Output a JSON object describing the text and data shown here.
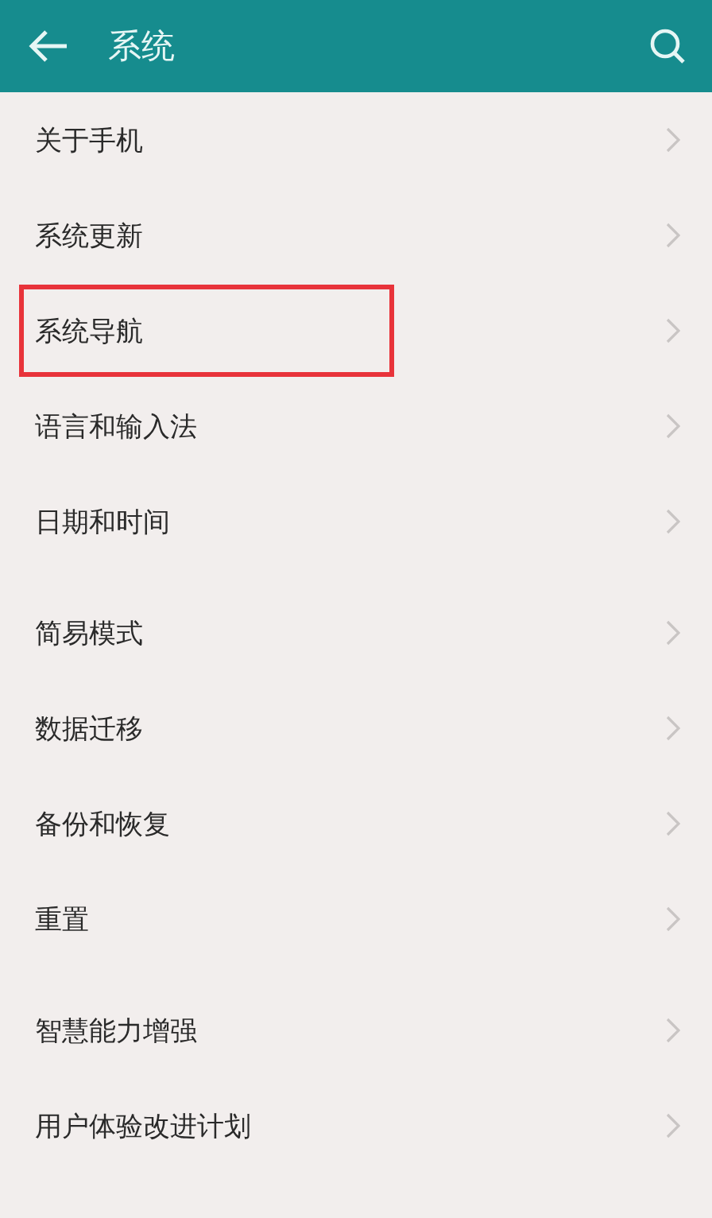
{
  "header": {
    "title": "系统"
  },
  "groups": [
    {
      "items": [
        {
          "label": "关于手机",
          "highlighted": false
        },
        {
          "label": "系统更新",
          "highlighted": false
        },
        {
          "label": "系统导航",
          "highlighted": true
        },
        {
          "label": "语言和输入法",
          "highlighted": false
        },
        {
          "label": "日期和时间",
          "highlighted": false
        }
      ]
    },
    {
      "items": [
        {
          "label": "简易模式",
          "highlighted": false
        },
        {
          "label": "数据迁移",
          "highlighted": false
        },
        {
          "label": "备份和恢复",
          "highlighted": false
        },
        {
          "label": "重置",
          "highlighted": false
        }
      ]
    },
    {
      "items": [
        {
          "label": "智慧能力增强",
          "highlighted": false
        },
        {
          "label": "用户体验改进计划",
          "highlighted": false
        }
      ]
    }
  ]
}
